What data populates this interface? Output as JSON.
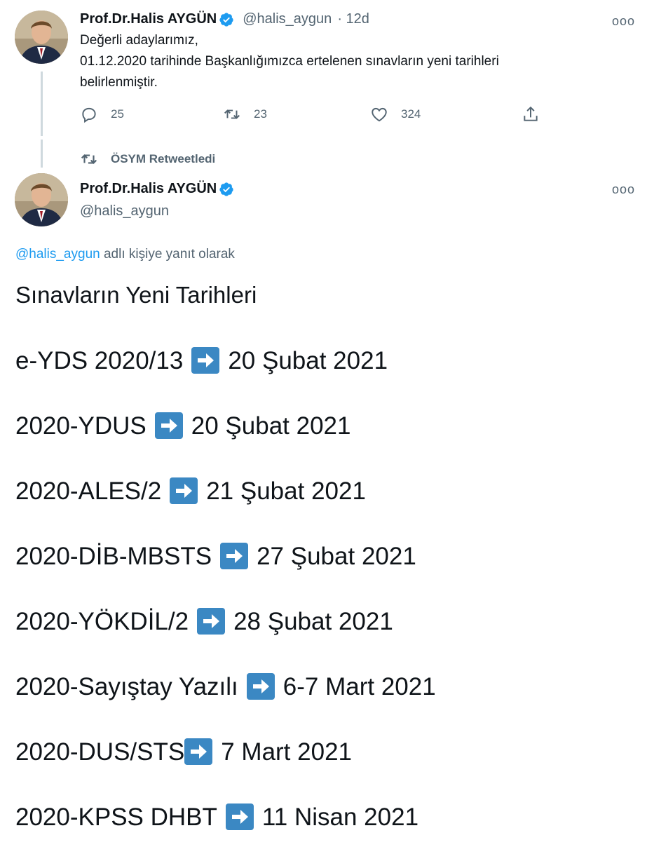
{
  "tweet1": {
    "author_name": "Prof.Dr.Halis AYGÜN",
    "handle": "@halis_aygun",
    "age": "· 12d",
    "more": "ooo",
    "lines": [
      "Değerli adaylarımız,",
      "01.12.2020 tarihinde Başkanlığımızca ertelenen sınavların yeni tarihleri",
      "belirlenmiştir."
    ],
    "actions": {
      "replies": "25",
      "retweets": "23",
      "likes": "324"
    }
  },
  "retweet_notice": "ÖSYM Retweetledi",
  "tweet2": {
    "author_name": "Prof.Dr.Halis AYGÜN",
    "handle": "@halis_aygun",
    "more": "ooo",
    "reply_mention": "@halis_aygun",
    "reply_suffix": " adlı kişiye yanıt olarak",
    "title": "Sınavların Yeni Tarihleri",
    "exams": [
      {
        "name": "e-YDS 2020/13",
        "date": "20 Şubat 2021"
      },
      {
        "name": "2020-YDUS",
        "date": "20 Şubat 2021"
      },
      {
        "name": "2020-ALES/2",
        "date": "21 Şubat 2021"
      },
      {
        "name": "2020-DİB-MBSTS",
        "date": "27 Şubat 2021"
      },
      {
        "name": "2020-YÖKDİL/2",
        "date": "28 Şubat 2021"
      },
      {
        "name": "2020-Sayıştay Yazılı",
        "date": "6-7 Mart 2021"
      },
      {
        "name": "2020-DUS/STS",
        "date": "7 Mart 2021"
      },
      {
        "name": "2020-KPSS DHBT",
        "date": "11 Nisan 2021"
      }
    ]
  },
  "colors": {
    "text": "#0f1419",
    "secondary": "#536471",
    "link": "#1d9bf0",
    "verified": "#1d9bf0",
    "arrow_emoji": "#3b88c3",
    "thread_line": "#cfd9de"
  },
  "icons": {
    "verified": "verified-badge-icon",
    "reply": "reply-icon",
    "retweet": "retweet-icon",
    "like": "heart-icon",
    "share": "share-icon",
    "arrow": "right-arrow-emoji-icon"
  }
}
